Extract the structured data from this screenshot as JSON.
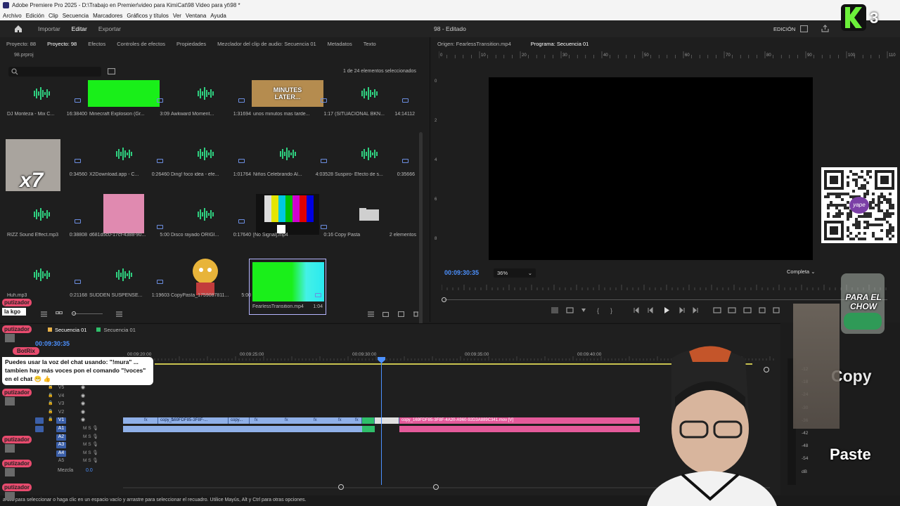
{
  "window": {
    "title": "Adobe Premiere Pro 2025 - D:\\Trabajo en Premier\\video para KimiCat\\98 Video para yt\\98 *"
  },
  "menu": [
    "Archivo",
    "Edición",
    "Clip",
    "Secuencia",
    "Marcadores",
    "Gráficos y títulos",
    "Ver",
    "Ventana",
    "Ayuda"
  ],
  "workspace": {
    "tabs": [
      "Importar",
      "Editar",
      "Exportar"
    ],
    "active": "Editar",
    "title": "98 - Editado",
    "mode": "EDICIÓN"
  },
  "project_panel": {
    "tabs": [
      "Proyecto: 88",
      "Proyecto: 98",
      "Efectos",
      "Controles de efectos",
      "Propiedades",
      "Mezclador del clip de audio: Secuencia 01",
      "Metadatos",
      "Texto"
    ],
    "active_tab": "Proyecto: 98",
    "project_file": "98.prproj",
    "selection_count": "1 de 24 elementos seleccionados",
    "items": [
      {
        "name": "DJ Monteza - Mix C...",
        "duration": "16:38400",
        "kind": "audio"
      },
      {
        "name": "Minecraft Explosion (Gr...",
        "duration": "3:09",
        "kind": "green"
      },
      {
        "name": "Awkward Moment...",
        "duration": "1:31694",
        "kind": "audio"
      },
      {
        "name": "unos minutos mas tarde...",
        "duration": "1:17",
        "kind": "minutes"
      },
      {
        "name": "(SITUACIONAL BKN...",
        "duration": "14:14112",
        "kind": "audio"
      },
      {
        "name": "",
        "duration": "0:34560",
        "kind": "monkey"
      },
      {
        "name": "X2Download.app - C...",
        "duration": "0:26460",
        "kind": "audio"
      },
      {
        "name": "Ding! foco idea - efe...",
        "duration": "1:01764",
        "kind": "audio"
      },
      {
        "name": "Niños Celebrando Al...",
        "duration": "4:03528",
        "kind": "audio"
      },
      {
        "name": "Suspiro- Efecto de s...",
        "duration": "0:35666",
        "kind": "audio"
      },
      {
        "name": "RIZZ Sound Effect.mp3",
        "duration": "0:38808",
        "kind": "audio"
      },
      {
        "name": "d681d5c0-17cf-4388-90...",
        "duration": "5:00",
        "kind": "pink"
      },
      {
        "name": "Disco rayado ORIGI...",
        "duration": "0:17640",
        "kind": "audio"
      },
      {
        "name": "[No Signal].mp4",
        "duration": "0:16",
        "kind": "bars"
      },
      {
        "name": "Copy Pasta",
        "duration": "2 elementos",
        "kind": "folder"
      },
      {
        "name": "Huh.mp3",
        "duration": "0:21168",
        "kind": "audio"
      },
      {
        "name": "SUDDEN SUSPENSE...",
        "duration": "1:19603",
        "kind": "audio"
      },
      {
        "name": "CopyPasta_1759087811...",
        "duration": "5:00",
        "kind": "cartoon"
      },
      {
        "name": "FearlessTransition.mp4",
        "duration": "1:04",
        "kind": "fearless"
      }
    ]
  },
  "monitor": {
    "tabs": [
      "Origen: FearlessTransition.mp4",
      "Programa: Secuencia 01"
    ],
    "active_tab": "Programa: Secuencia 01",
    "timecode": "00:09:30:35",
    "zoom": "36%",
    "quality": "Completa",
    "ruler_marks": [
      "0",
      "2",
      "4",
      "6",
      "8",
      "10",
      "12",
      "14",
      "16",
      "18",
      "20",
      "22",
      "24",
      "26",
      "28",
      "30",
      "32",
      "34",
      "36",
      "38",
      "40",
      "42",
      "44",
      "46",
      "48",
      "50",
      "52",
      "54",
      "56",
      "58",
      "60",
      "62",
      "64",
      "66",
      "68",
      "70",
      "72",
      "74",
      "76",
      "78",
      "80",
      "82",
      "84",
      "86",
      "88",
      "90",
      "92",
      "94",
      "96",
      "98",
      "100",
      "102",
      "104",
      "106",
      "108",
      "110"
    ],
    "vertical_marks": [
      "0",
      "2",
      "4",
      "6",
      "8"
    ]
  },
  "timeline": {
    "tabs": [
      "Secuencia 01",
      "Secuencia 01"
    ],
    "timecode": "00:09:30:35",
    "ruler": [
      "00:09:20:00",
      "00:09:25:00",
      "00:09:30:00",
      "00:09:35:00",
      "00:09:40:00"
    ],
    "video_tracks": [
      "V5",
      "V4",
      "V3",
      "V2",
      "V1"
    ],
    "audio_tracks": [
      "A1",
      "A2",
      "A3",
      "A4",
      "A5"
    ],
    "mix_label": "Mezcla",
    "mix_value": "0.0",
    "clips": {
      "v1_a": "copy_169FDF85-3F8F-...",
      "v1_b": "copy...",
      "v1_pink": "copy_169FDF85-3F8F-4A20-A960-92D3A889C341.mov [V]",
      "fx": "fx"
    }
  },
  "meter_scale": [
    "-12",
    "-18",
    "-24",
    "-30",
    "-36",
    "-42",
    "-48",
    "-54",
    "dB"
  ],
  "status": "a clic para seleccionar o haga clic en un espacio vacío y arrastre para seleccionar el recuadro. Utilice Mayús, Alt y Ctrl para otras opciones.",
  "overlay": {
    "chat": [
      {
        "user": "putizador",
        "message": "la kgo"
      },
      {
        "user": "putizador",
        "message": ""
      },
      {
        "user": "putizador",
        "message": ""
      },
      {
        "user": "putizador",
        "message": ""
      },
      {
        "user": "putizador",
        "message": ""
      },
      {
        "user": "putizador",
        "message": ""
      }
    ],
    "bot": {
      "user": "BotRix",
      "message": "Puedes usar la voz del chat usando: \"!mura\" ... tambien hay más voces pon el comando \"!voces\" en el chat 😁 👍"
    },
    "x7": "x7",
    "logo_number": "3",
    "para_el_chow": "PARA EL CHOW",
    "copy": "Copy",
    "paste": "Paste",
    "qr_label": "yape"
  },
  "colors": {
    "accent": "#4c91ff",
    "clip_blue": "#8fb0e8",
    "clip_pink": "#e45a9a",
    "clip_green": "#2fbf6a",
    "chat_pink": "#e84b6e"
  }
}
